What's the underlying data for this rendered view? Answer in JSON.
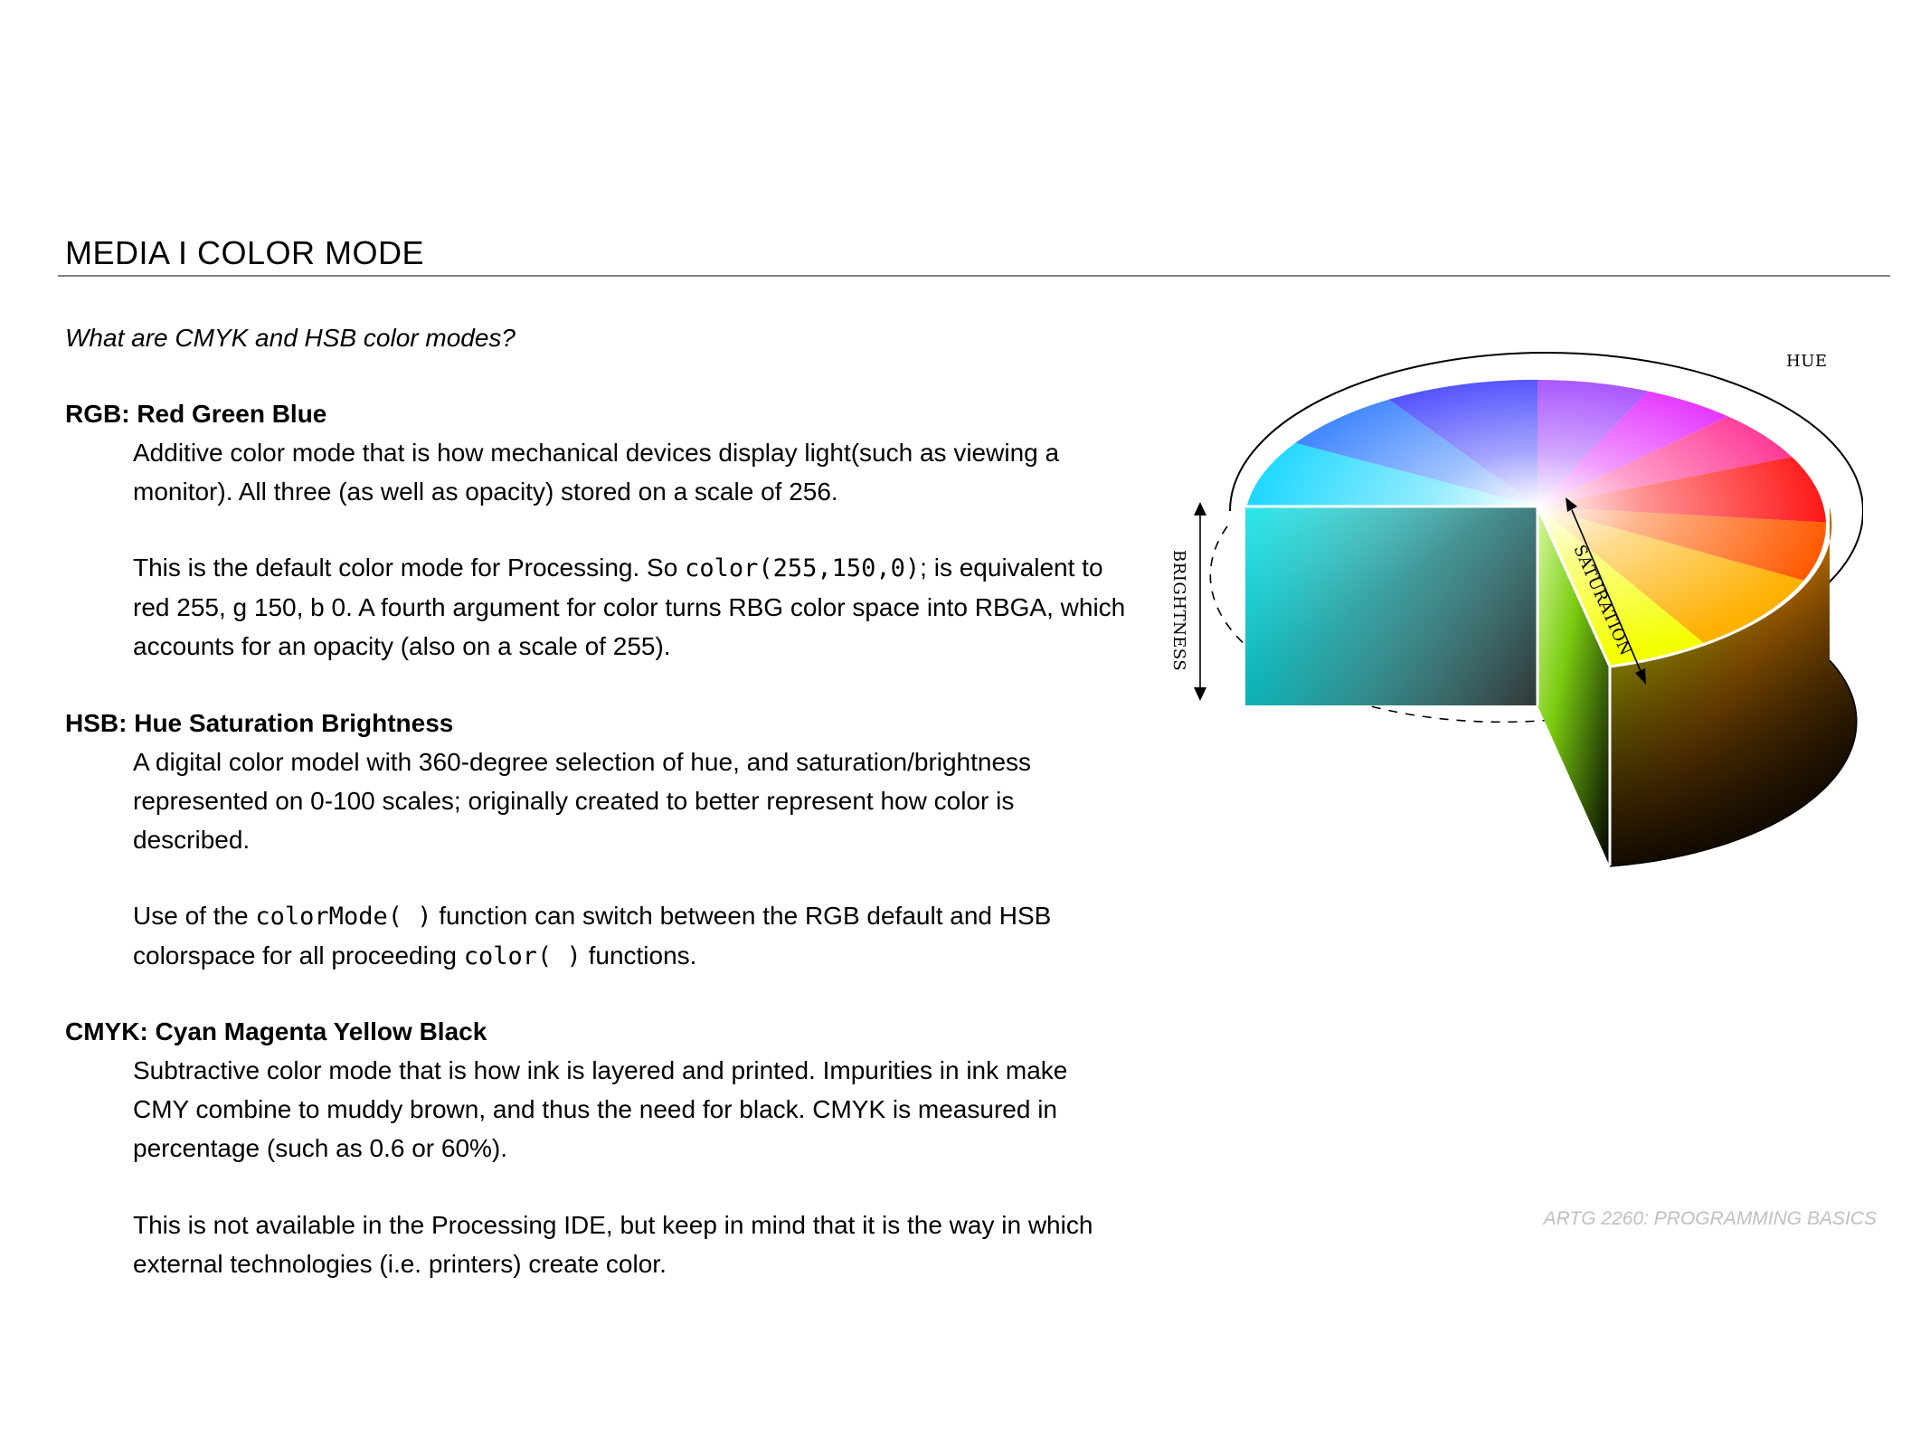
{
  "slide": {
    "title": "MEDIA  I  COLOR MODE",
    "question": "What are CMYK and HSB color modes?"
  },
  "rgb": {
    "heading": "RGB: Red Green Blue",
    "p1": "Additive color mode that is how mechanical devices display light(such as viewing a monitor). All three (as well as opacity) stored on a scale of 256.",
    "p2_before": "This is the default color mode for Processing. So ",
    "p2_code": "color(255,150,0)",
    "p2_after": "; is equivalent to red 255, g 150, b 0. A fourth argument for color turns RBG color space into RBGA, which accounts for an opacity (also on a scale of 255)."
  },
  "hsb": {
    "heading": "HSB: Hue Saturation Brightness",
    "p1": "A digital color model with 360-degree selection of hue, and saturation/brightness represented on 0-100 scales; originally created to better represent how color is described.",
    "p2_before": "Use of the ",
    "p2_code1": "colorMode( )",
    "p2_middle": " function can switch between the RGB default and HSB colorspace for all proceeding ",
    "p2_code2": "color( )",
    "p2_after": " functions."
  },
  "cmyk": {
    "heading": "CMYK: Cyan Magenta Yellow Black",
    "p1": "Subtractive color mode that is how ink is layered and printed. Impurities in ink make CMY combine to muddy brown, and thus the need for black. CMYK is measured in percentage (such as 0.6 or 60%).",
    "p2": "This is not available in the Processing IDE, but keep in mind that it is the way in which external technologies (i.e. printers) create color."
  },
  "diagram": {
    "hue_label": "HUE",
    "saturation_label": "SATURATION",
    "brightness_label": "BRIGHTNESS"
  },
  "footer": {
    "text": "ARTG 2260: PROGRAMMING BASICS"
  }
}
